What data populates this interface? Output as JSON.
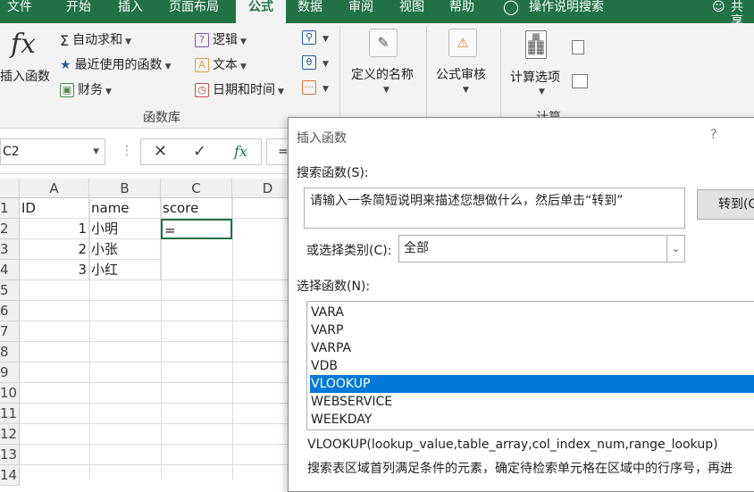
{
  "tabs": [
    "文件",
    "开始",
    "插入",
    "页面布局",
    "公式",
    "数据",
    "审阅",
    "视图",
    "帮助",
    "操作说明搜索",
    "共享"
  ],
  "active_tab": "公式",
  "ribbon": {
    "insert_function": "插入函数",
    "autosum": "自动求和",
    "recent": "最近使用的函数",
    "finance": "财务",
    "logic": "逻辑",
    "text": "文本",
    "datetime": "日期和时间",
    "group_label": "函数库",
    "defined_names": "定义的名称",
    "formula_audit": "公式审核",
    "calc_options": "计算选项",
    "calc_group": "计算"
  },
  "formula_bar": {
    "name_box": "C2",
    "content": "="
  },
  "grid": {
    "columns": [
      "A",
      "B",
      "C",
      "D"
    ],
    "rows": [
      "1",
      "2",
      "3",
      "4",
      "5",
      "6",
      "7",
      "8",
      "9",
      "10",
      "11",
      "12",
      "13",
      "14"
    ],
    "cells": {
      "A1": "ID",
      "B1": "name",
      "C1": "score",
      "A2": "1",
      "B2": "小明",
      "C2": "=",
      "A3": "2",
      "B3": "小张",
      "A4": "3",
      "B4": "小红"
    }
  },
  "dialog": {
    "title": "插入函数",
    "help": "?",
    "search_label": "搜索函数(S):",
    "search_value": "请输入一条简短说明来描述您想做什么，然后单击“转到”",
    "go_button": "转到(G",
    "category_label": "或选择类别(C):",
    "category_value": "全部",
    "select_label": "选择函数(N):",
    "functions": [
      "VARA",
      "VARP",
      "VARPA",
      "VDB",
      "VLOOKUP",
      "WEBSERVICE",
      "WEEKDAY"
    ],
    "selected": "VLOOKUP",
    "signature": "VLOOKUP(lookup_value,table_array,col_index_num,range_lookup)",
    "description": "搜索表区域首列满足条件的元素，确定待检索单元格在区域中的行序号，再进"
  },
  "colors": {
    "ribbon_green": "#217346",
    "selection_blue": "#0078d7"
  }
}
